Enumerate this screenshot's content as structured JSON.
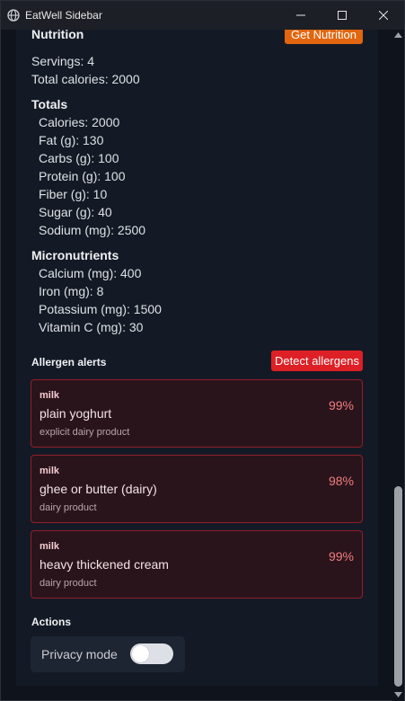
{
  "window": {
    "title": "EatWell Sidebar"
  },
  "nutrition": {
    "heading": "Nutrition",
    "button_label": "Get Nutrition",
    "servings": "Servings: 4",
    "total_calories": "Total calories: 2000",
    "totals_heading": "Totals",
    "totals": [
      "Calories: 2000",
      "Fat (g): 130",
      "Carbs (g): 100",
      "Protein (g): 100",
      "Fiber (g): 10",
      "Sugar (g): 40",
      "Sodium (mg): 2500"
    ],
    "micros_heading": "Micronutrients",
    "micros": [
      "Calcium (mg): 400",
      "Iron (mg): 8",
      "Potassium (mg): 1500",
      "Vitamin C (mg): 30"
    ]
  },
  "allergens": {
    "heading": "Allergen alerts",
    "button_label": "Detect allergens",
    "alerts": [
      {
        "allergen": "milk",
        "food": "plain yoghurt",
        "reason": "explicit dairy product",
        "confidence": "99%"
      },
      {
        "allergen": "milk",
        "food": "ghee or butter (dairy)",
        "reason": "dairy product",
        "confidence": "98%"
      },
      {
        "allergen": "milk",
        "food": "heavy thickened cream",
        "reason": "dairy product",
        "confidence": "99%"
      }
    ]
  },
  "actions": {
    "heading": "Actions",
    "privacy_label": "Privacy mode",
    "privacy_on": false
  },
  "colors": {
    "accent_orange": "#e2650f",
    "alert_red": "#dd2025",
    "panel_bg": "#141a25"
  }
}
